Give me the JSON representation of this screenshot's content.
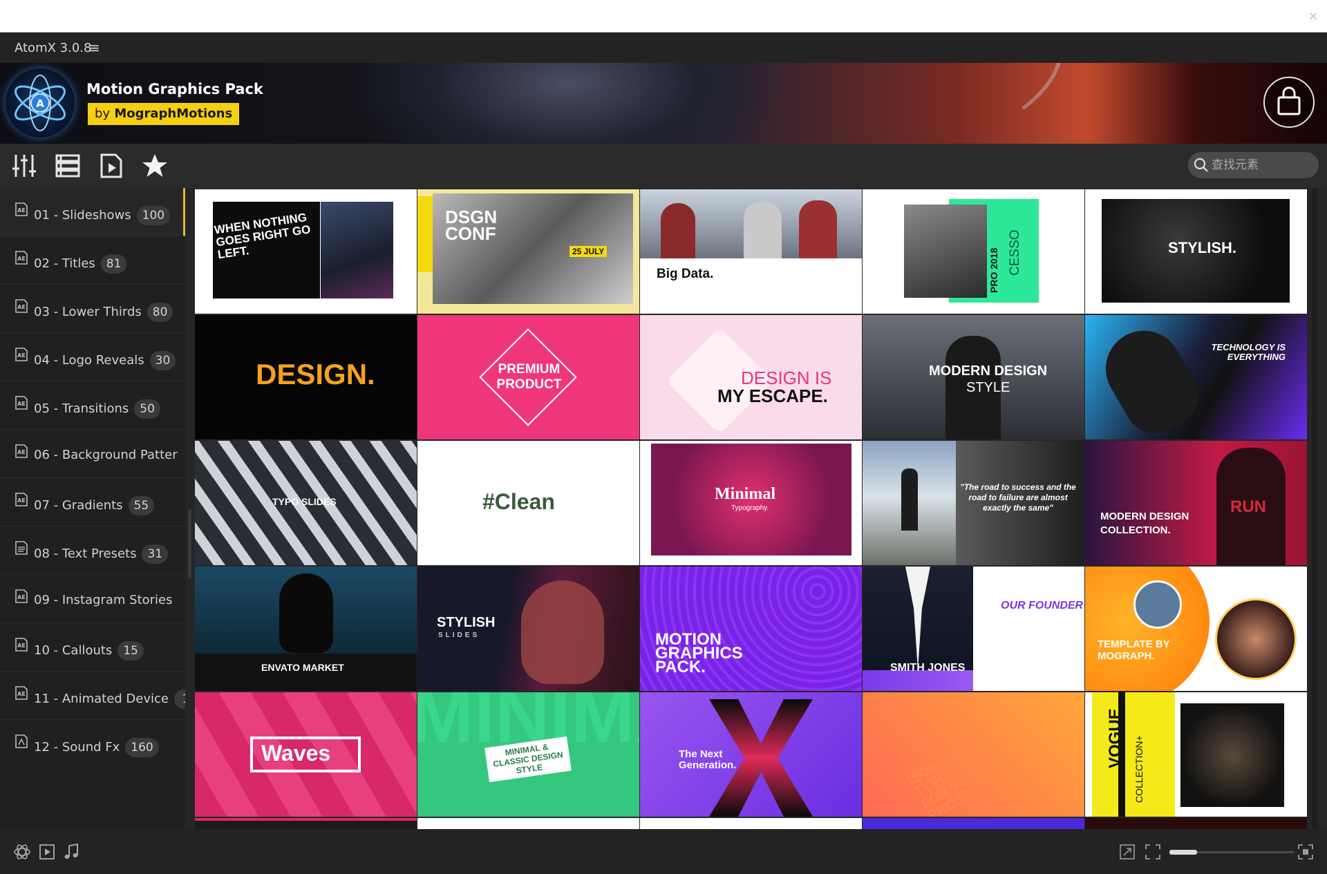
{
  "app": {
    "title": "AtomX 3.0.8",
    "menu_glyph": "≡",
    "close_glyph": "×"
  },
  "pack": {
    "title": "Motion Graphics Pack",
    "author_prefix": "by",
    "author": "MographMotions"
  },
  "search": {
    "placeholder": "查找元素"
  },
  "categories": [
    {
      "label": "01 - Slideshows",
      "count": "100",
      "icon": "ae-file-icon",
      "active": true
    },
    {
      "label": "02 - Titles",
      "count": "81",
      "icon": "ae-file-icon"
    },
    {
      "label": "03 - Lower Thirds",
      "count": "80",
      "icon": "ae-file-icon"
    },
    {
      "label": "04 - Logo Reveals",
      "count": "30",
      "icon": "ae-file-icon"
    },
    {
      "label": "05 - Transitions",
      "count": "50",
      "icon": "ae-file-icon"
    },
    {
      "label": "06 - Background Patter",
      "count": "",
      "icon": "ae-file-icon"
    },
    {
      "label": "07 - Gradients",
      "count": "55",
      "icon": "ae-file-icon"
    },
    {
      "label": "08 - Text Presets",
      "count": "31",
      "icon": "document-icon"
    },
    {
      "label": "09 - Instagram Stories",
      "count": "",
      "icon": "ae-file-icon"
    },
    {
      "label": "10 - Callouts",
      "count": "15",
      "icon": "ae-file-icon"
    },
    {
      "label": "11 - Animated Device",
      "count": "1",
      "icon": "ae-file-icon"
    },
    {
      "label": "12 - Sound Fx",
      "count": "160",
      "icon": "sound-file-icon"
    }
  ],
  "thumbnails": [
    {
      "text": "WHEN NOTHING GOES RIGHT GO LEFT."
    },
    {
      "text": "DSGN CONF",
      "sub": "25 JULY"
    },
    {
      "text": "Big Data."
    },
    {
      "text": "PRO 2018",
      "sub": "CESSO"
    },
    {
      "text": "STYLISH."
    },
    {
      "text": "DESIGN."
    },
    {
      "text": "PREMIUM PRODUCT"
    },
    {
      "text": "DESIGN IS",
      "sub": "MY ESCAPE."
    },
    {
      "text": "MODERN DESIGN",
      "sub": "STYLE"
    },
    {
      "text": "TECHNOLOGY IS EVERYTHING"
    },
    {
      "text": "TYPO SLIDES"
    },
    {
      "text": "#Clean"
    },
    {
      "text": "Minimal",
      "sub": "Typography."
    },
    {
      "text": "\"The road to success and the road to failure are almost exactly the same\""
    },
    {
      "text": "MODERN DESIGN COLLECTION.",
      "sub": "RUN"
    },
    {
      "text": "ENVATO MARKET"
    },
    {
      "text": "STYLISH",
      "sub": "SLIDES"
    },
    {
      "text": "MOTION GRAPHICS PACK."
    },
    {
      "text": "OUR FOUNDER",
      "sub": "SMITH JONES"
    },
    {
      "text": "TEMPLATE BY MOGRAPH."
    },
    {
      "text": "Waves"
    },
    {
      "text": "MINIMAL & CLASSIC DESIGN STYLE"
    },
    {
      "text": "The Next Generation."
    },
    {
      "text": "ISOMETRIC TYPOGRAPHY FOR YOUR PROJECT."
    },
    {
      "text": "VOGUE",
      "sub": "COLLECTION+"
    }
  ],
  "zoom": {
    "level": 0.22
  }
}
